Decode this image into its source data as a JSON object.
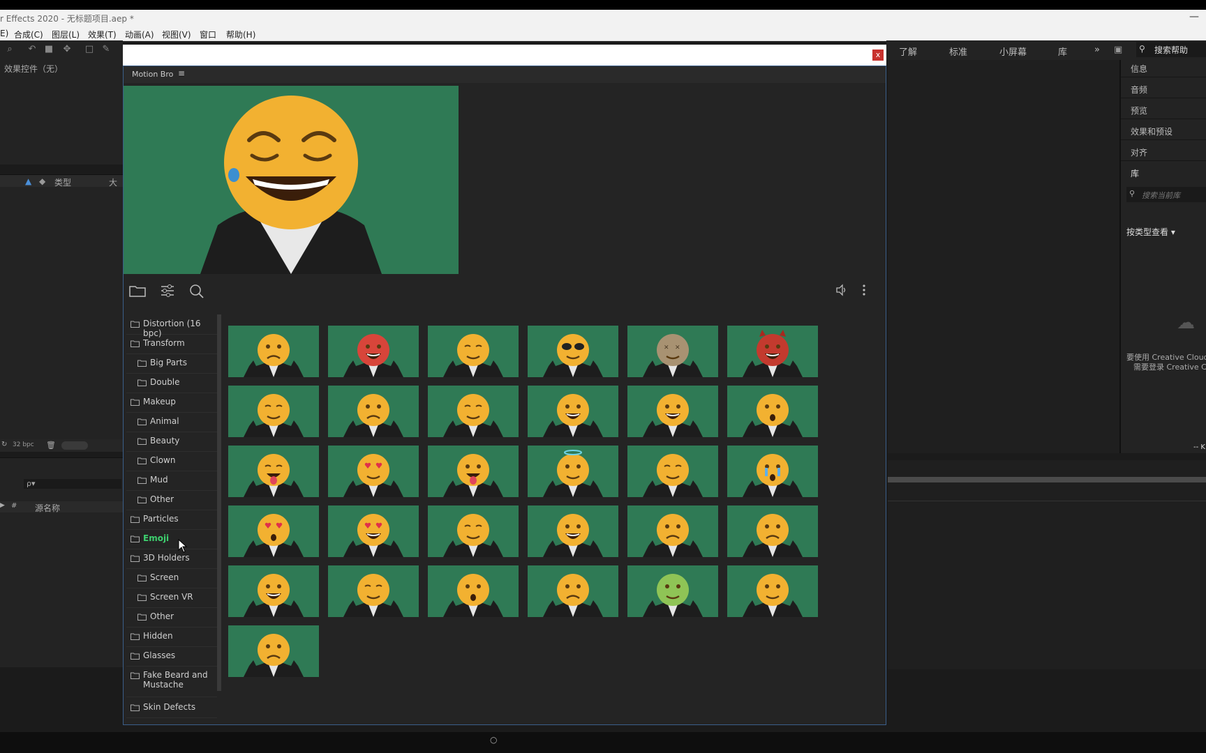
{
  "app": {
    "title": "r Effects 2020 - 无标题项目.aep *",
    "minimize": "—"
  },
  "menu": [
    "E)",
    "合成(C)",
    "图层(L)",
    "效果(T)",
    "动画(A)",
    "视图(V)",
    "窗口",
    "帮助(H)"
  ],
  "workspace": {
    "tabs": [
      "了解",
      "标准",
      "小屏幕",
      "库"
    ],
    "more": "»",
    "search_label": "搜索帮助"
  },
  "effect_controls": {
    "label": "效果控件（无）"
  },
  "project": {
    "col_type": "类型",
    "col_size": "大小",
    "bpc": "32 bpc"
  },
  "timeline_left": {
    "search_placeholder": "ρ▾",
    "col_num": "#",
    "col_source": "源名称"
  },
  "right_panel": {
    "items": [
      "信息",
      "音频",
      "预览",
      "效果和预设",
      "对齐",
      "库"
    ],
    "library_search": "搜索当前库",
    "view_by": "按类型查看 ▾",
    "cc_line1": "要使用 Creative Cloud",
    "cc_line2": "需要登录 Creative C",
    "corner": "-- K"
  },
  "motion_bro": {
    "close_label": "x",
    "tab": "Motion Bro",
    "menu_glyph": "≡",
    "tools": [
      "folder-icon",
      "sliders-icon",
      "search-icon"
    ],
    "right_tools": [
      "speaker-icon",
      "more-vertical-icon"
    ],
    "active_category": "Emoji",
    "accent": "#3dcf6e",
    "categories": [
      {
        "label": "Distortion (16 bpc)",
        "indent": false
      },
      {
        "label": "Transform",
        "indent": false
      },
      {
        "label": "Big Parts",
        "indent": true
      },
      {
        "label": "Double",
        "indent": true
      },
      {
        "label": "Makeup",
        "indent": false
      },
      {
        "label": "Animal",
        "indent": true
      },
      {
        "label": "Beauty",
        "indent": true
      },
      {
        "label": "Clown",
        "indent": true
      },
      {
        "label": "Mud",
        "indent": true
      },
      {
        "label": "Other",
        "indent": true
      },
      {
        "label": "Particles",
        "indent": false
      },
      {
        "label": "Emoji",
        "indent": false
      },
      {
        "label": "3D Holders",
        "indent": false
      },
      {
        "label": "Screen",
        "indent": true
      },
      {
        "label": "Screen VR",
        "indent": true
      },
      {
        "label": "Other",
        "indent": true
      },
      {
        "label": "Hidden",
        "indent": false
      },
      {
        "label": "Glasses",
        "indent": false
      },
      {
        "label": "Fake Beard and Mustache",
        "indent": false
      },
      {
        "label": "Skin Defects",
        "indent": false
      }
    ],
    "presets": [
      {
        "face": "#f2b131",
        "mood": "frown"
      },
      {
        "face": "#d8453a",
        "mood": "angry"
      },
      {
        "face": "#f2b131",
        "mood": "content"
      },
      {
        "face": "#f2b131",
        "mood": "cool"
      },
      {
        "face": "#a89272",
        "mood": "dizzy"
      },
      {
        "face": "#c33a2e",
        "mood": "devil"
      },
      {
        "face": "#f2b131",
        "mood": "smirk"
      },
      {
        "face": "#f2b131",
        "mood": "unamused"
      },
      {
        "face": "#f2b131",
        "mood": "wink"
      },
      {
        "face": "#f2b131",
        "mood": "grin"
      },
      {
        "face": "#f2b131",
        "mood": "laugh"
      },
      {
        "face": "#f2b131",
        "mood": "shock"
      },
      {
        "face": "#f2b131",
        "mood": "tongue-wink"
      },
      {
        "face": "#f2b131",
        "mood": "heart-eyes"
      },
      {
        "face": "#f2b131",
        "mood": "tongue"
      },
      {
        "face": "#f2b131",
        "mood": "halo"
      },
      {
        "face": "#f2b131",
        "mood": "kiss"
      },
      {
        "face": "#f2b131",
        "mood": "cry"
      },
      {
        "face": "#f2b131",
        "mood": "heart-shout"
      },
      {
        "face": "#f2b131",
        "mood": "heart-smile"
      },
      {
        "face": "#f2b131",
        "mood": "relieved"
      },
      {
        "face": "#f2b131",
        "mood": "grin"
      },
      {
        "face": "#f2b131",
        "mood": "sad"
      },
      {
        "face": "#f2b131",
        "mood": "sad"
      },
      {
        "face": "#f2b131",
        "mood": "happy"
      },
      {
        "face": "#f2b131",
        "mood": "sleepy"
      },
      {
        "face": "#f2b131",
        "mood": "surprise"
      },
      {
        "face": "#f2b131",
        "mood": "sad"
      },
      {
        "face": "#8fc456",
        "mood": "sick"
      },
      {
        "face": "#f2b131",
        "mood": "confused"
      },
      {
        "face": "#f2b131",
        "mood": "worried"
      }
    ]
  }
}
